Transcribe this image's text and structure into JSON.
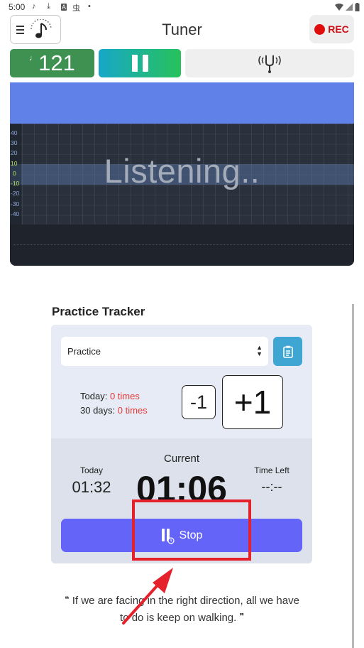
{
  "status_bar": {
    "time": "5:00",
    "left_icons": [
      "music-note-icon",
      "download-icon",
      "a-badge-icon",
      "app-icon",
      "dot-icon"
    ],
    "right_icons": [
      "wifi-icon",
      "signal-icon",
      "battery-icon"
    ]
  },
  "header": {
    "title": "Tuner",
    "menu_icon": "hamburger-icon",
    "logo_icon": "metronome-note-icon",
    "rec_label": "REC",
    "rec_color": "#e00d0d"
  },
  "controls": {
    "bpm_note": "♩",
    "bpm_value": "121",
    "bpm_color": "#3e9150",
    "pause_icon": "pause-icon",
    "fork_icon": "tuning-fork-icon"
  },
  "tuner": {
    "status_text": "Listening..",
    "scale_ticks": [
      "40",
      "30",
      "20",
      "10",
      "0",
      "-10",
      "-20",
      "-30",
      "-40"
    ],
    "in_tune_ticks": [
      "10",
      "0",
      "-10"
    ],
    "top_color": "#5f81e8"
  },
  "practice": {
    "title": "Practice Tracker",
    "select_value": "Practice",
    "clipboard_icon": "clipboard-icon",
    "today_count_label": "Today:",
    "today_count_value": "0 times",
    "days30_label": "30 days:",
    "days30_value": "0 times",
    "minus_label": "-1",
    "plus_label": "+1",
    "today_label": "Today",
    "today_value": "01:32",
    "current_label": "Current",
    "current_value": "01:06",
    "time_left_label": "Time Left",
    "time_left_value": "--:--",
    "stop_label": "Stop",
    "stop_color": "#6465f8"
  },
  "quote": {
    "open_mark": "❝",
    "text": "If we are facing in the right direction, all we have to do is keep on walking.",
    "close_mark": "❞"
  },
  "annotation": {
    "color": "#e5222c"
  }
}
